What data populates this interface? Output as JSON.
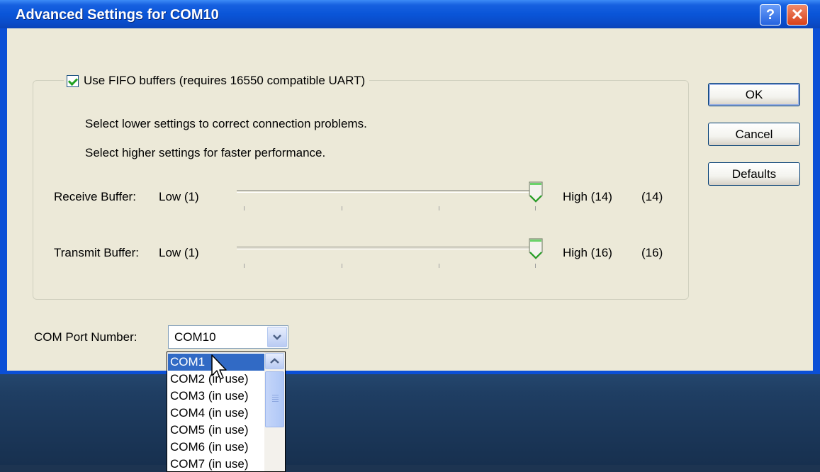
{
  "window": {
    "title": "Advanced Settings for COM10",
    "help_label": "?",
    "close_label": "✕"
  },
  "fifo": {
    "checkbox_label": "Use FIFO buffers (requires 16550 compatible UART)",
    "checked": true,
    "hint_lower": "Select lower settings to correct connection problems.",
    "hint_higher": "Select higher settings for faster performance."
  },
  "receive": {
    "label": "Receive Buffer:",
    "low_label": "Low (1)",
    "high_label": "High (14)",
    "value_display": "(14)",
    "value": 14,
    "min": 1,
    "max": 14
  },
  "transmit": {
    "label": "Transmit Buffer:",
    "low_label": "Low (1)",
    "high_label": "High (16)",
    "value_display": "(16)",
    "value": 16,
    "min": 1,
    "max": 16
  },
  "buttons": {
    "ok": "OK",
    "cancel": "Cancel",
    "defaults": "Defaults"
  },
  "com_port": {
    "label": "COM Port Number:",
    "selected": "COM10",
    "options": [
      "COM1",
      "COM2 (in use)",
      "COM3 (in use)",
      "COM4 (in use)",
      "COM5 (in use)",
      "COM6 (in use)",
      "COM7 (in use)"
    ],
    "highlighted_index": 0
  },
  "colors": {
    "title_bar": "#0a55d8",
    "dialog_bg": "#ece9d8",
    "selection": "#316ac5",
    "thumb_accent": "#21a121"
  },
  "icons": {
    "help": "help-icon",
    "close": "close-icon",
    "check": "checkmark-icon",
    "dropdown": "chevron-down-icon",
    "scroll_up": "chevron-up-icon",
    "cursor": "mouse-pointer-icon"
  }
}
